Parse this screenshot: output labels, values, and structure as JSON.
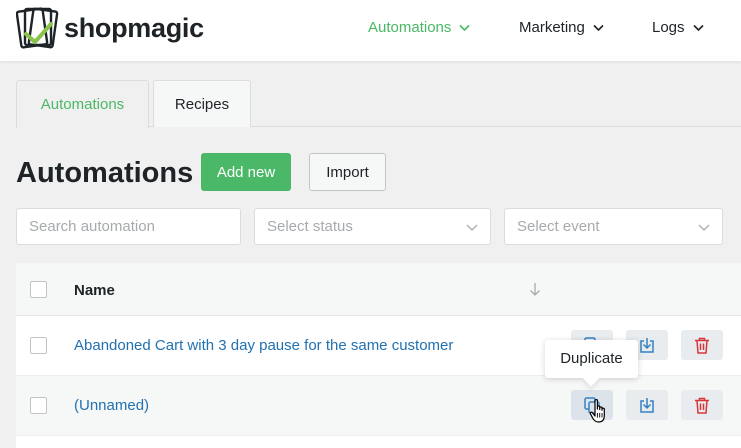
{
  "brand": {
    "name": "shopmagic"
  },
  "nav": [
    {
      "label": "Automations",
      "active": true
    },
    {
      "label": "Marketing",
      "active": false
    },
    {
      "label": "Logs",
      "active": false
    }
  ],
  "tabs": [
    {
      "label": "Automations",
      "active": true
    },
    {
      "label": "Recipes",
      "active": false
    }
  ],
  "page": {
    "title": "Automations",
    "add_new_label": "Add new",
    "import_label": "Import"
  },
  "filters": {
    "search_placeholder": "Search automation",
    "status_placeholder": "Select status",
    "event_placeholder": "Select event"
  },
  "table": {
    "columns": {
      "name": "Name"
    },
    "rows": [
      {
        "name": "Abandoned Cart with 3 day pause for the same customer"
      },
      {
        "name": "(Unnamed)"
      }
    ]
  },
  "tooltip": {
    "text": "Duplicate"
  },
  "colors": {
    "accent": "#4ab866",
    "link": "#2271b1",
    "action_blue": "#3582c4",
    "danger": "#d63638"
  },
  "icons": {
    "logo": "shopmagic-logo-icon",
    "chevron": "chevron-down-icon",
    "sort": "sort-arrow-down-icon",
    "duplicate": "duplicate-icon",
    "export": "download-icon",
    "delete": "trash-icon",
    "cursor": "hand-pointer-icon"
  }
}
